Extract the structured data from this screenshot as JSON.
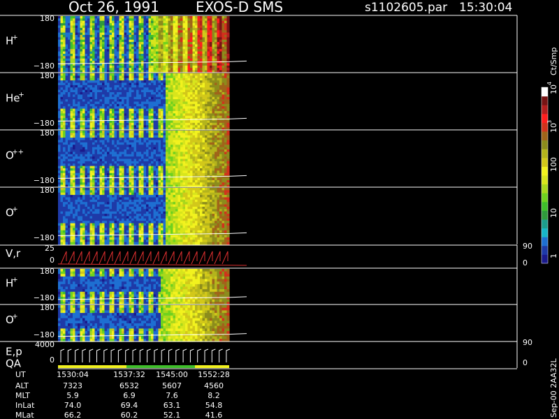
{
  "header": {
    "date": "Oct 26, 1991",
    "instrument": "EXOS-D SMS",
    "file": "s1102605.par",
    "time": "15:30:04"
  },
  "panels": [
    {
      "label": "H",
      "sup": "+",
      "ymax": "180",
      "ymin": "−180"
    },
    {
      "label": "He",
      "sup": "+",
      "ymax": "180",
      "ymin": "−180"
    },
    {
      "label": "O",
      "sup": "++",
      "ymax": "180",
      "ymin": "−180"
    },
    {
      "label": "O",
      "sup": "+",
      "ymax": "180",
      "ymin": "−180"
    },
    {
      "label": "V,r",
      "sup": "",
      "ymax": "25",
      "ymin": "0",
      "right_top": "90",
      "right_bottom": "0"
    },
    {
      "label": "H",
      "sup": "+",
      "ymax": "180",
      "ymin": "−180"
    },
    {
      "label": "O",
      "sup": "+",
      "ymax": "180",
      "ymin": "−180"
    },
    {
      "label": "E,p",
      "label2": "QA",
      "sup": "",
      "ymax": "4000",
      "ymin": "0",
      "right_top": "90",
      "right_bottom": "0"
    }
  ],
  "colorbar": {
    "unit": "Ct/Smp",
    "ticks": [
      {
        "text": "10",
        "sup": "4"
      },
      {
        "text": "10",
        "sup": "3"
      },
      {
        "text": "100",
        "sup": ""
      },
      {
        "text": "10",
        "sup": ""
      },
      {
        "text": "1",
        "sup": ""
      }
    ],
    "colors": [
      "#1a1a8c",
      "#1e3aa8",
      "#1e6fd2",
      "#17b5c8",
      "#1c9c8c",
      "#2f9a3c",
      "#3fbf2a",
      "#6fd21e",
      "#a8d81c",
      "#d8e51c",
      "#f2f21e",
      "#d2c81a",
      "#b4b41c",
      "#8c8c1c",
      "#a0641a",
      "#d2321c",
      "#ff1e1e",
      "#b41e1e",
      "#781414",
      "#ffffff"
    ]
  },
  "footer": {
    "rows": [
      {
        "label": "UT",
        "values": [
          "1530:04",
          "1537:32",
          "1545:00",
          "1552:28"
        ]
      },
      {
        "label": "ALT",
        "values": [
          "7323",
          "6532",
          "5607",
          "4560"
        ]
      },
      {
        "label": "MLT",
        "values": [
          "5.9",
          "6.9",
          "7.6",
          "8.2"
        ]
      },
      {
        "label": "InLat",
        "values": [
          "74.0",
          "69.4",
          "63.1",
          "54.8"
        ]
      },
      {
        "label": "MLat",
        "values": [
          "66.2",
          "60.2",
          "52.1",
          "41.6"
        ]
      }
    ],
    "side_label": "Sep-00  2AA32L"
  },
  "chart_data": {
    "type": "heatmap",
    "title": "Oct 26, 1991    EXOS-D SMS",
    "x_ticks": [
      "1530:04",
      "1537:32",
      "1545:00",
      "1552:28"
    ],
    "panels": [
      "H+",
      "He+",
      "O++",
      "O+",
      "V,r",
      "H+",
      "O+",
      "E,p QA"
    ],
    "colorbar_label": "Ct/Smp",
    "colorbar_ticks": [
      "10^4",
      "10^3",
      "100",
      "10",
      "1"
    ]
  }
}
